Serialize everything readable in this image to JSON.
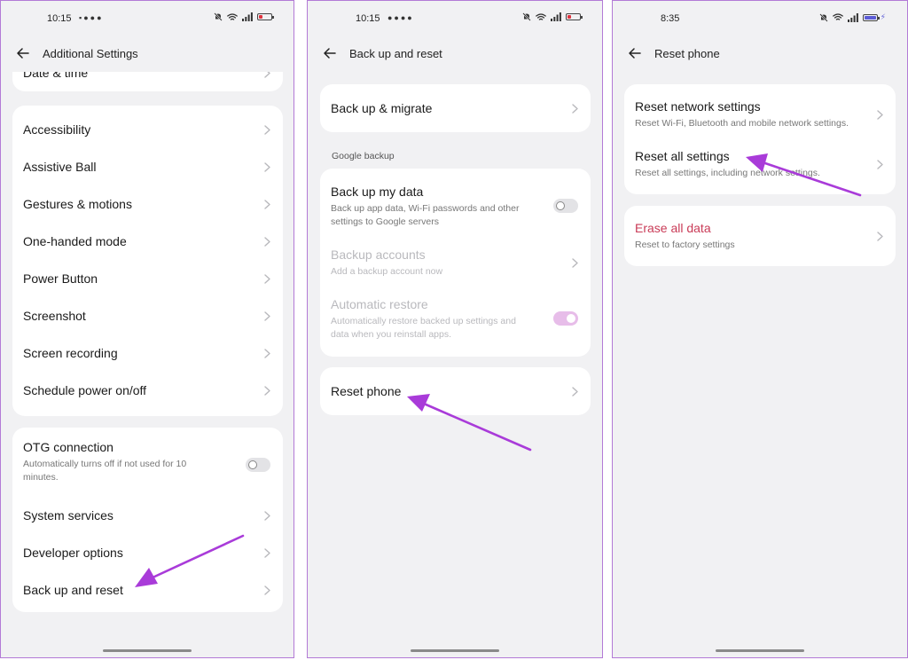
{
  "panel1": {
    "status_time": "10:15",
    "title": "Additional Settings",
    "partial_item": "Date & time",
    "group_a": [
      "Accessibility",
      "Assistive Ball",
      "Gestures & motions",
      "One-handed mode",
      "Power Button",
      "Screenshot",
      "Screen recording",
      "Schedule power on/off"
    ],
    "otg": {
      "label": "OTG connection",
      "desc_line1": "Automatically turns off if not used for 10",
      "desc_line2": "minutes."
    },
    "group_b": [
      "System services",
      "Developer options",
      "Back up and reset"
    ]
  },
  "panel2": {
    "status_time": "10:15",
    "title": "Back up and reset",
    "migrate": "Back up & migrate",
    "section_google": "Google backup",
    "backup_my_data": {
      "label": "Back up my data",
      "desc_line1": "Back up app data, Wi-Fi passwords and other",
      "desc_line2": "settings to Google servers"
    },
    "backup_accounts": {
      "label": "Backup accounts",
      "desc": "Add a backup account now"
    },
    "auto_restore": {
      "label": "Automatic restore",
      "desc_line1": "Automatically restore backed up settings and",
      "desc_line2": "data when you reinstall apps."
    },
    "reset_phone": "Reset phone"
  },
  "panel3": {
    "status_time": "8:35",
    "title": "Reset phone",
    "reset_network": {
      "label": "Reset network settings",
      "desc": "Reset Wi-Fi, Bluetooth and mobile network settings."
    },
    "reset_all": {
      "label": "Reset all settings",
      "desc": "Reset all settings, including network settings."
    },
    "erase": {
      "label": "Erase all data",
      "desc": "Reset to factory settings"
    }
  },
  "colors": {
    "accent_arrow": "#a93bd9",
    "danger": "#c93b57",
    "border": "#b37ad6",
    "bg": "#f1f1f3",
    "toggle_on": "#e7bde9"
  },
  "icons": [
    "back-arrow-icon",
    "chevron-right-icon",
    "wifi-icon",
    "signal-icon",
    "battery-icon",
    "mute-bell-icon",
    "pointer-arrow"
  ]
}
